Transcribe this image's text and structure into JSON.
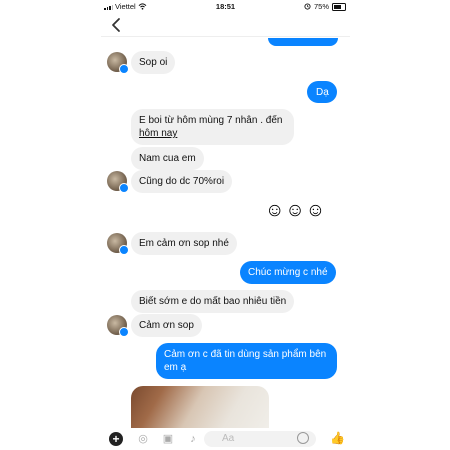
{
  "status_bar": {
    "carrier": "Viettel",
    "time": "18:51",
    "battery": "75%",
    "icons": [
      "signal-icon",
      "wifi-icon",
      "alarm-icon",
      "battery-icon"
    ]
  },
  "nav": {
    "back_icon": "chevron-left-icon"
  },
  "messages": [
    {
      "side": "in",
      "text": "Sop oi"
    },
    {
      "side": "out",
      "text": "Dạ"
    },
    {
      "side": "in",
      "text_line1": "E boi từ hôm mùng 7 nhân . đến",
      "text_line2": "hôm nay"
    },
    {
      "side": "in",
      "text": "Nam cua em"
    },
    {
      "side": "in",
      "text": "Cũng do dc 70%roi"
    },
    {
      "side": "out",
      "text": "☺☺☺"
    },
    {
      "side": "in",
      "text": "Em cảm ơn sop nhé"
    },
    {
      "side": "out",
      "text": "Chúc mừng c nhé"
    },
    {
      "side": "in",
      "text": "Biết sớm e do mất bao nhiêu tiền"
    },
    {
      "side": "in",
      "text": "Cảm ơn sop"
    },
    {
      "side": "out",
      "text_line1": "Cảm ơn c đã tin dùng sản phẩm bên",
      "text_line2": "em ạ"
    }
  ],
  "composer": {
    "placeholder": "Aa",
    "icons": [
      "plus-icon",
      "camera-icon",
      "image-icon",
      "mic-icon",
      "emoji-icon",
      "thumbs-up-icon"
    ]
  },
  "colors": {
    "accent": "#0a84ff",
    "incoming_bubble": "#f0f0f0"
  }
}
